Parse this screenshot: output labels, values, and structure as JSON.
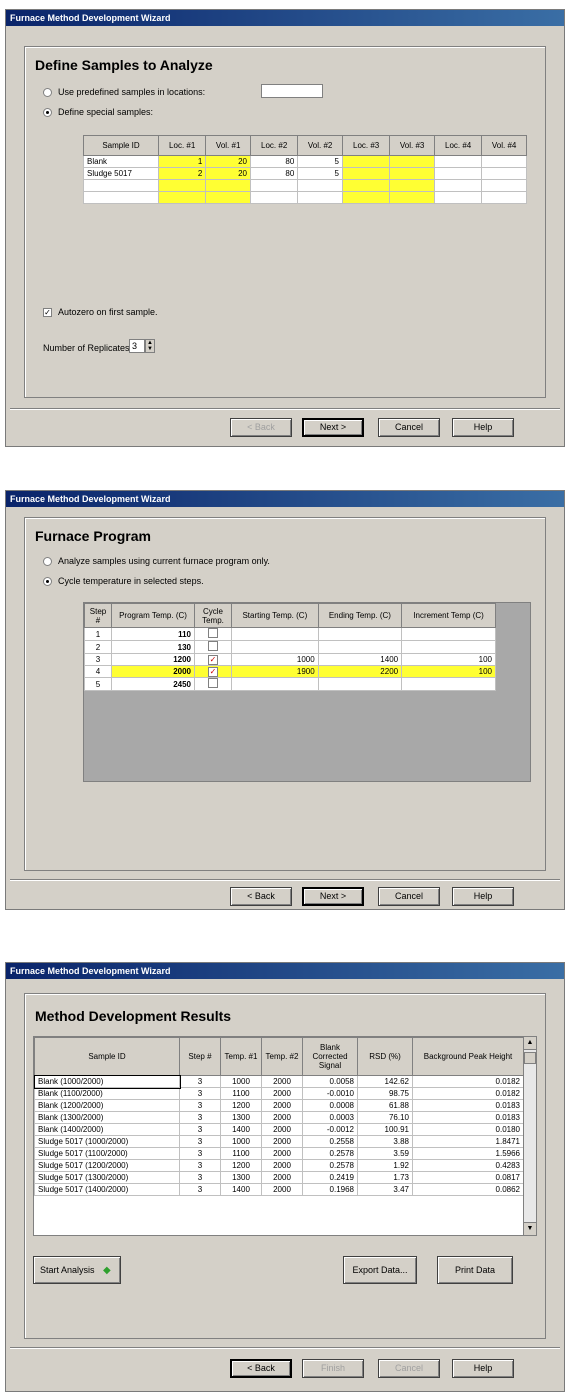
{
  "w1": {
    "title": "Furnace Method Development Wizard",
    "heading": "Define Samples to Analyze",
    "opt_predefined": "Use predefined samples in locations:",
    "opt_special": "Define special samples:",
    "columns": [
      "Sample ID",
      "Loc. #1",
      "Vol. #1",
      "Loc. #2",
      "Vol. #2",
      "Loc. #3",
      "Vol. #3",
      "Loc. #4",
      "Vol. #4"
    ],
    "rows": [
      [
        "Blank",
        "1",
        "20",
        "80",
        "5",
        "",
        "",
        "",
        ""
      ],
      [
        "Sludge 5017",
        "2",
        "20",
        "80",
        "5",
        "",
        "",
        "",
        ""
      ],
      [
        "",
        "",
        "",
        "",
        "",
        "",
        "",
        "",
        ""
      ],
      [
        "",
        "",
        "",
        "",
        "",
        "",
        "",
        "",
        ""
      ]
    ],
    "autozero": "Autozero on first sample.",
    "replicates_label": "Number of Replicates:",
    "replicates_value": "3",
    "back": "< Back",
    "next": "Next >",
    "cancel": "Cancel",
    "help": "Help"
  },
  "w2": {
    "title": "Furnace Method Development Wizard",
    "heading": "Furnace Program",
    "opt_current": "Analyze samples using current furnace program only.",
    "opt_cycle": "Cycle temperature in selected steps.",
    "columns": [
      "Step #",
      "Program Temp. (C)",
      "Cycle Temp.",
      "Starting Temp. (C)",
      "Ending Temp. (C)",
      "Increment Temp (C)"
    ],
    "rows": [
      {
        "step": "1",
        "prog": "110",
        "cycle": false,
        "start": "",
        "end": "",
        "inc": ""
      },
      {
        "step": "2",
        "prog": "130",
        "cycle": false,
        "start": "",
        "end": "",
        "inc": ""
      },
      {
        "step": "3",
        "prog": "1200",
        "cycle": true,
        "start": "1000",
        "end": "1400",
        "inc": "100"
      },
      {
        "step": "4",
        "prog": "2000",
        "cycle": true,
        "start": "1900",
        "end": "2200",
        "inc": "100"
      },
      {
        "step": "5",
        "prog": "2450",
        "cycle": false,
        "start": "",
        "end": "",
        "inc": ""
      }
    ],
    "back": "< Back",
    "next": "Next >",
    "cancel": "Cancel",
    "help": "Help"
  },
  "w3": {
    "title": "Furnace Method Development Wizard",
    "heading": "Method Development Results",
    "columns": [
      "Sample ID",
      "Step #",
      "Temp. #1",
      "Temp. #2",
      "Blank Corrected Signal",
      "RSD (%)",
      "Background Peak Height"
    ],
    "rows": [
      [
        "Blank (1000/2000)",
        "3",
        "1000",
        "2000",
        "0.0058",
        "142.62",
        "0.0182"
      ],
      [
        "Blank (1100/2000)",
        "3",
        "1100",
        "2000",
        "-0.0010",
        "98.75",
        "0.0182"
      ],
      [
        "Blank (1200/2000)",
        "3",
        "1200",
        "2000",
        "0.0008",
        "61.88",
        "0.0183"
      ],
      [
        "Blank (1300/2000)",
        "3",
        "1300",
        "2000",
        "0.0003",
        "76.10",
        "0.0183"
      ],
      [
        "Blank (1400/2000)",
        "3",
        "1400",
        "2000",
        "-0.0012",
        "100.91",
        "0.0180"
      ],
      [
        "Sludge 5017 (1000/2000)",
        "3",
        "1000",
        "2000",
        "0.2558",
        "3.88",
        "1.8471"
      ],
      [
        "Sludge 5017 (1100/2000)",
        "3",
        "1100",
        "2000",
        "0.2578",
        "3.59",
        "1.5966"
      ],
      [
        "Sludge 5017 (1200/2000)",
        "3",
        "1200",
        "2000",
        "0.2578",
        "1.92",
        "0.4283"
      ],
      [
        "Sludge 5017 (1300/2000)",
        "3",
        "1300",
        "2000",
        "0.2419",
        "1.73",
        "0.0817"
      ],
      [
        "Sludge 5017 (1400/2000)",
        "3",
        "1400",
        "2000",
        "0.1968",
        "3.47",
        "0.0862"
      ]
    ],
    "start_analysis": "Start Analysis",
    "export": "Export Data...",
    "print": "Print Data",
    "back": "< Back",
    "finish": "Finish",
    "cancel": "Cancel",
    "help": "Help"
  }
}
